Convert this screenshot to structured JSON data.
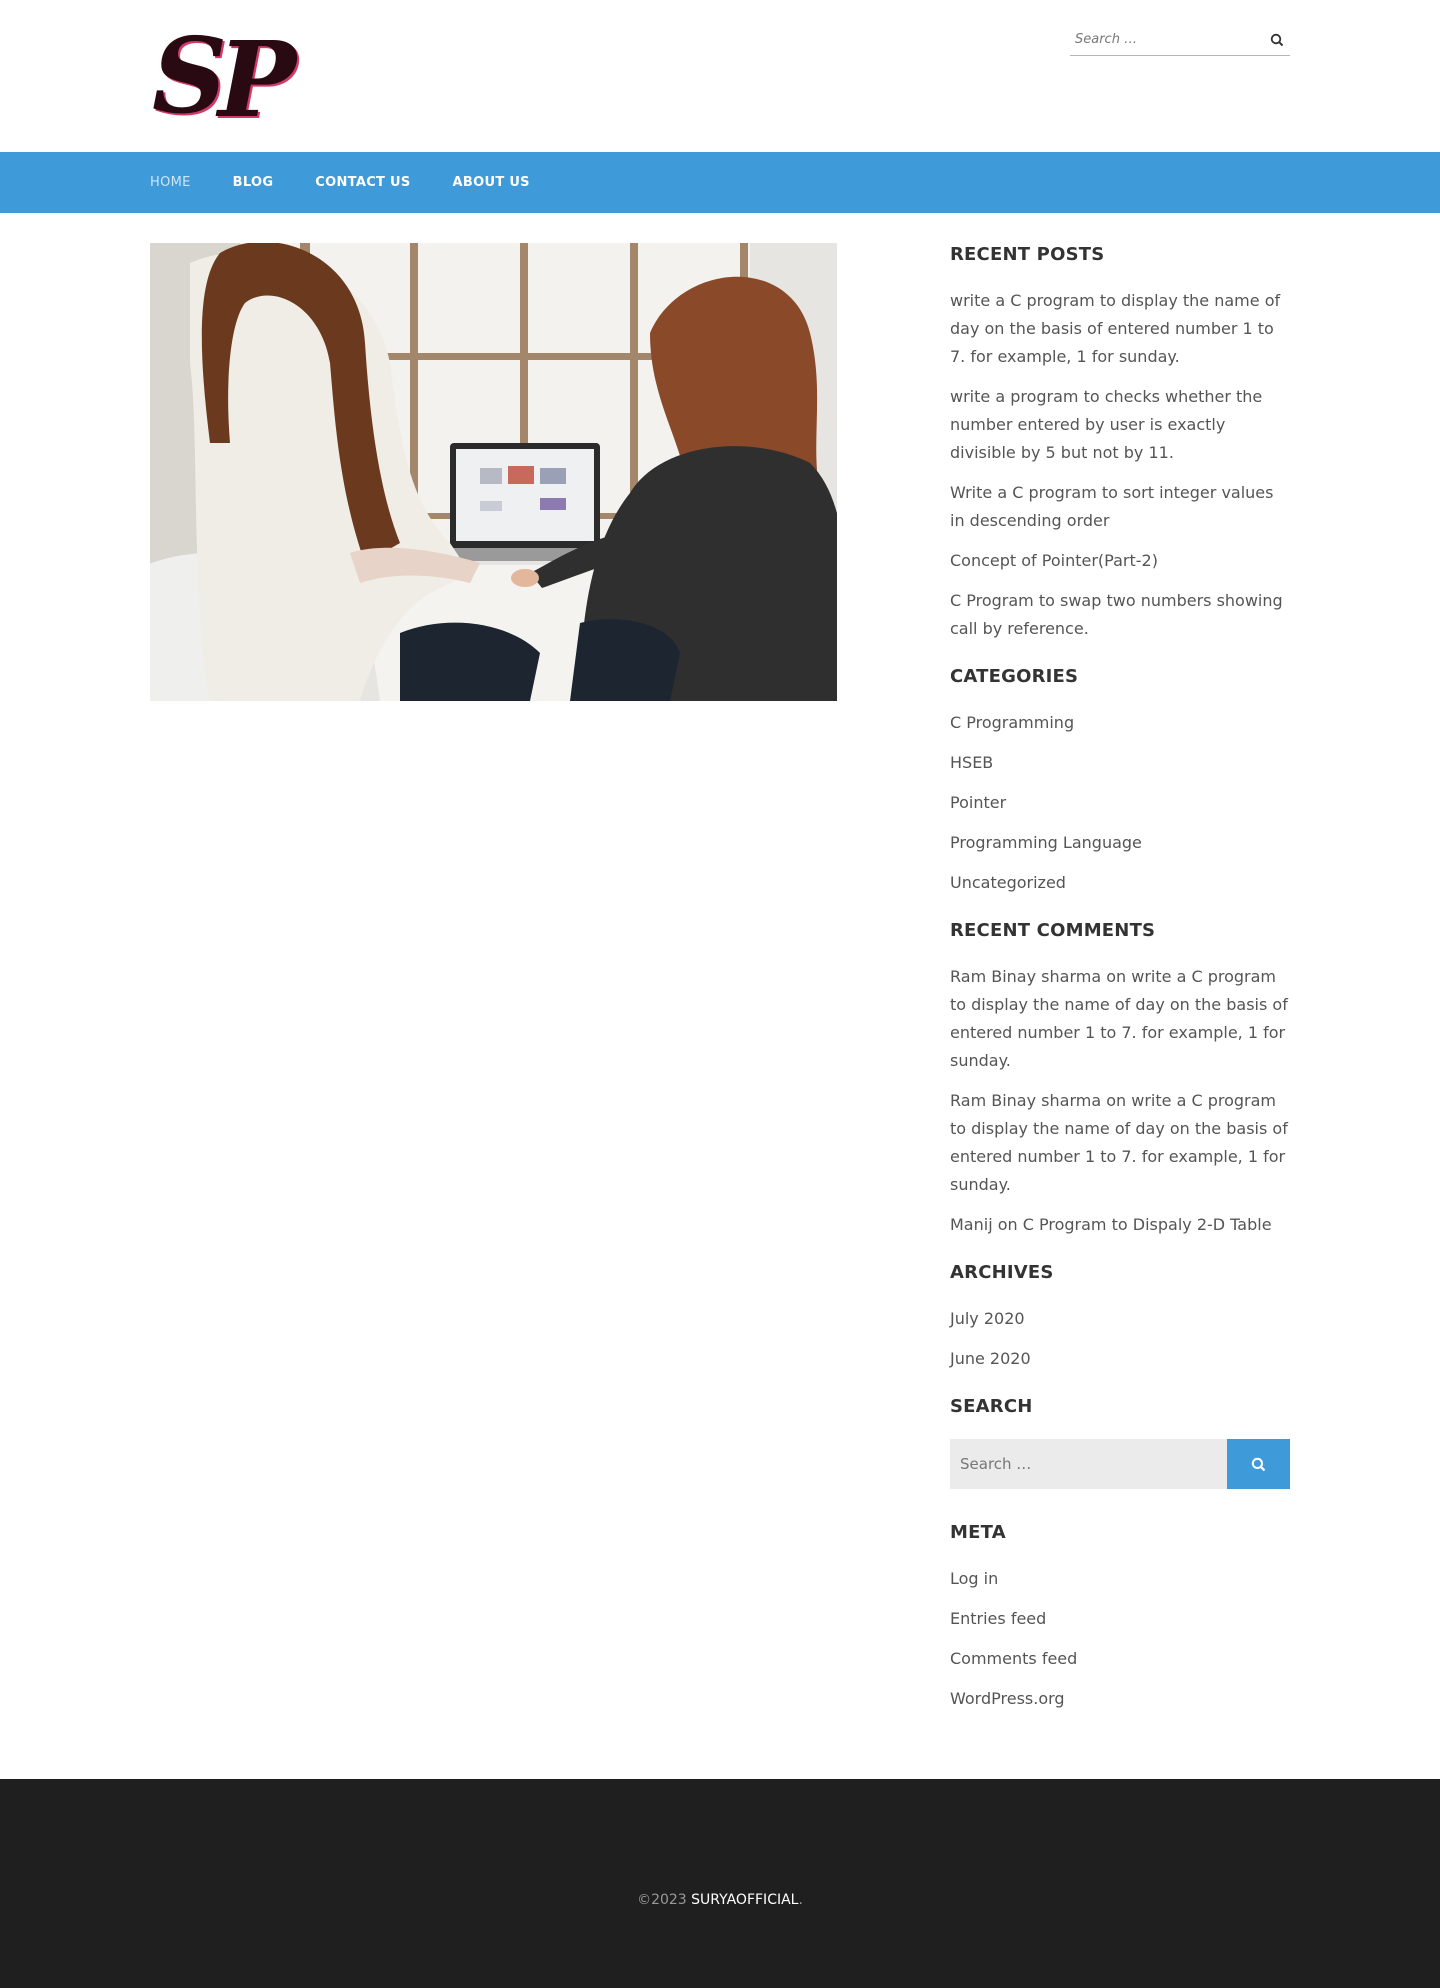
{
  "header": {
    "logo_alt": "SP",
    "search": {
      "placeholder": "Search …"
    }
  },
  "nav": {
    "items": [
      {
        "label": "HOME",
        "active": true
      },
      {
        "label": "BLOG"
      },
      {
        "label": "CONTACT US"
      },
      {
        "label": "ABOUT US"
      }
    ]
  },
  "sidebar": {
    "recent_posts": {
      "title": "RECENT POSTS",
      "items": [
        "write a C program to display the name of day on the basis of entered number 1 to 7. for example, 1 for sunday.",
        "write a program to checks whether the number entered by user is exactly divisible by 5 but not by 11.",
        "Write a C program to sort integer values in descending order",
        "Concept of Pointer(Part-2)",
        "C Program to swap two numbers showing call by reference."
      ]
    },
    "categories": {
      "title": "CATEGORIES",
      "items": [
        "C Programming",
        "HSEB",
        "Pointer",
        "Programming Language",
        "Uncategorized"
      ]
    },
    "recent_comments": {
      "title": "RECENT COMMENTS",
      "items": [
        {
          "author": "Ram Binay sharma",
          "on": " on ",
          "post": "write a C program to display the name of day on the basis of entered number 1 to 7. for example, 1 for sunday."
        },
        {
          "author": "Ram Binay sharma",
          "on": " on ",
          "post": "write a C program to display the name of day on the basis of entered number 1 to 7. for example, 1 for sunday."
        },
        {
          "author": "Manij",
          "on": " on ",
          "post": "C Program to Dispaly 2-D Table"
        }
      ]
    },
    "archives": {
      "title": "ARCHIVES",
      "items": [
        "July 2020",
        "June 2020"
      ]
    },
    "search": {
      "title": "SEARCH",
      "placeholder": "Search …"
    },
    "meta": {
      "title": "META",
      "items": [
        "Log in",
        "Entries feed",
        "Comments feed",
        "WordPress.org"
      ]
    }
  },
  "footer": {
    "copyright": "©2023 ",
    "brand": "SURYAOFFICIAL",
    "suffix": "."
  },
  "colors": {
    "nav_bg": "#3e9ad9",
    "footer_bg": "#1f1f1f",
    "logo_fill": "#2a0a12",
    "logo_outline": "#d23a6a"
  }
}
